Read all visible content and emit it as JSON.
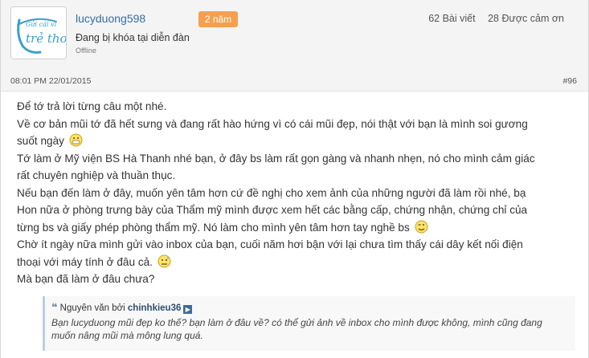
{
  "user": {
    "name": "lucyduong598",
    "badge": "2 năm",
    "title": "Đang bị khóa tại diễn đàn",
    "status": "Offline",
    "posts": "62 Bài viết",
    "thanks": "28 Được cảm ơn",
    "avatar_text": "Gửi cái vì\ntrẻ thơ"
  },
  "post": {
    "timestamp": "08:01 PM 22/01/2015",
    "number": "#96",
    "lines": [
      "Để tớ trả lời từng câu một nhé.",
      "Về cơ bản mũi tớ đã hết sưng và đang rất hào hứng vì có cái mũi đẹp, nói thật với bạn là mình soi gương",
      "suốt ngày",
      "Tớ làm ở Mỹ viện BS Hà Thanh nhé bạn, ở đây bs làm rất gọn gàng và nhanh nhẹn, nó cho mình cảm giác",
      "rất chuyên nghiệp và thuần thục.",
      "Nếu bạn đến làm ở đây, muốn yên tâm hơn cứ đề nghị cho xem ảnh của những người đã làm rồi nhé, bạ",
      "Hon nữa ở phòng trưng bày của Thẩm mỹ mình được xem hết các bằng cấp, chứng nhận, chứng chỉ của",
      "từng bs và giấy phép phòng thẩm mỹ. Nó làm cho mình yên tâm hơn tay nghề bs",
      "Chờ ít ngày nữa mình gửi vào inbox của bạn, cuối năm hơi bận với lại chưa tìm thấy cái dây kết nối điện",
      "thoại với máy tính ở đâu cả.",
      "Mà bạn đã làm ở đâu chưa?"
    ]
  },
  "quote": {
    "prefix": "Nguyên văn bởi",
    "author": "chinhkieu36",
    "text": "Bạn lucyduong mũi đẹp ko thế? bạn làm ở đâu về? có thể gửi ảnh về inbox cho mình được không, mình cũng đang muốn nâng mũi mà mông lung quá."
  },
  "colors": {
    "accent": "#2f6fa8",
    "badge": "#f5a04e",
    "quote_border": "#b9cfe0"
  }
}
